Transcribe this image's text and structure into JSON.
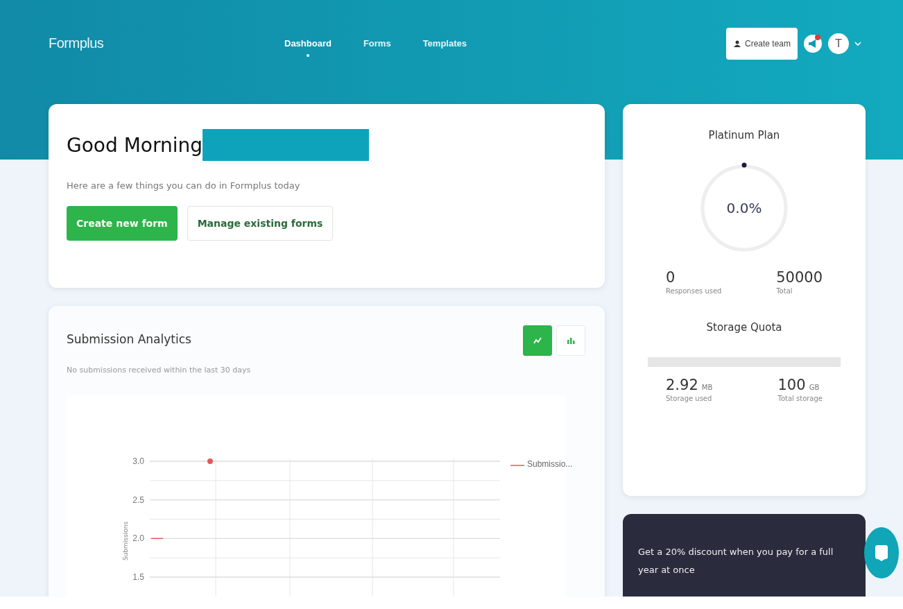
{
  "header": {
    "logo": "Formplus",
    "nav": [
      {
        "label": "Dashboard",
        "selected": true
      },
      {
        "label": "Forms",
        "selected": false
      },
      {
        "label": "Templates",
        "selected": false
      }
    ],
    "create_team": "Create team",
    "notification": true,
    "avatar": "T"
  },
  "welcome": {
    "greeting": "Good Morning",
    "name_redacted": true,
    "subtitle": "Here are a few things you can do in Formplus today",
    "buttons": [
      {
        "label": "Create new form",
        "kind": "primary"
      },
      {
        "label": "Manage existing forms",
        "kind": "secondary"
      }
    ]
  },
  "analytics": {
    "title": "Submission Analytics",
    "toggles": [
      {
        "kind": "line",
        "selected": true
      },
      {
        "kind": "bar",
        "selected": false
      }
    ],
    "note": "No submissions received within the last 30 days",
    "chart_data": {
      "type": "line",
      "ylabel": "Submissions",
      "ylim": [
        1.5,
        3.0
      ],
      "yticks": [
        {
          "value": 3.0,
          "label": "3.0"
        },
        {
          "value": 2.5,
          "label": "2.5"
        },
        {
          "value": 2.0,
          "label": "2.0"
        },
        {
          "value": 1.5,
          "label": "1.5"
        }
      ],
      "series": [
        {
          "name": "Submissio...",
          "color": "#e05a5a",
          "values": [
            2,
            2,
            null,
            null,
            null,
            3,
            null,
            null,
            null,
            null,
            null,
            null,
            null,
            null,
            null,
            null,
            null,
            null,
            null,
            null,
            null,
            null,
            null,
            null,
            null,
            null,
            null,
            null,
            null,
            null
          ]
        }
      ]
    }
  },
  "plan": {
    "title": "Platinum Plan",
    "level": 0,
    "percent": "0.0%",
    "used": "0",
    "used_label": "Responses used",
    "total": "50000",
    "total_label": "Total",
    "storage_title": "Storage Quota",
    "storage_used": "2.92",
    "storage_used_unit": "MB",
    "storage_used_label": "Storage used",
    "storage_total": "100",
    "storage_total_unit": "GB",
    "storage_total_label": "Total storage"
  },
  "promo": {
    "text": "Get a 20% discount when you pay for a full year at once"
  }
}
